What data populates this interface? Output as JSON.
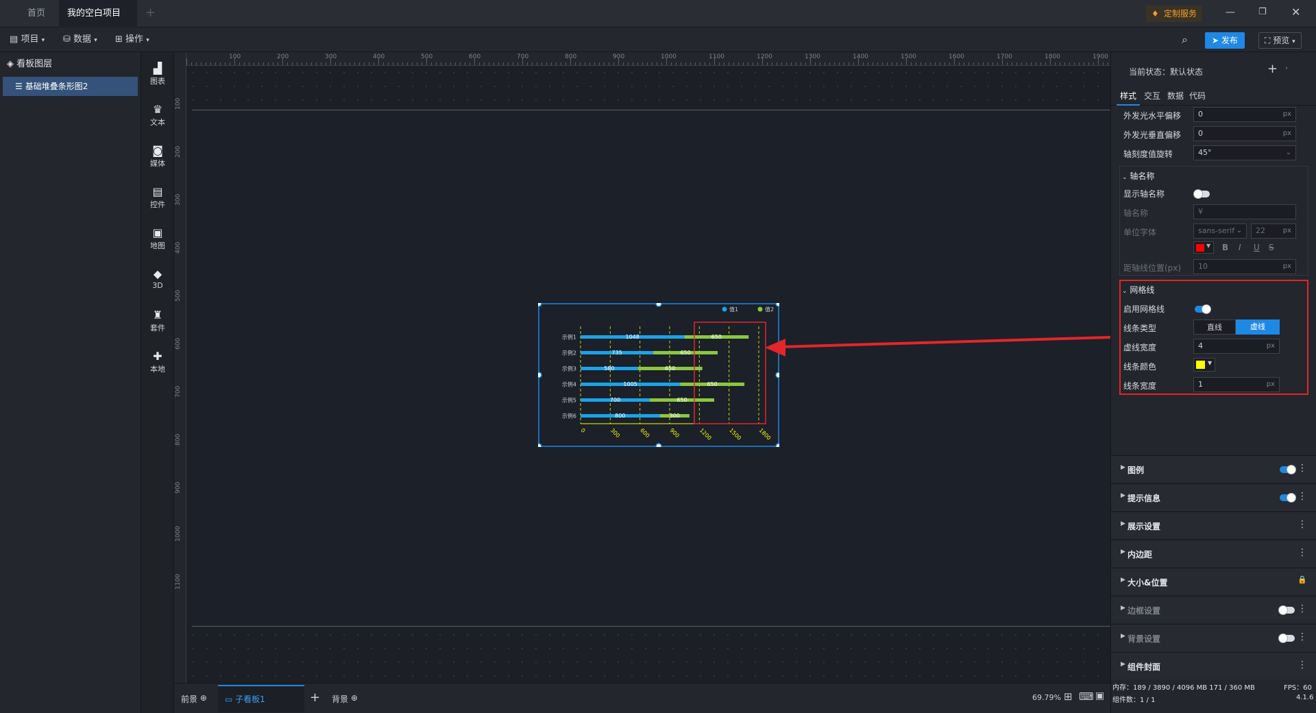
{
  "tabs": [
    {
      "label": "首页",
      "active": false
    },
    {
      "label": "我的空白项目",
      "active": true,
      "modified": true
    }
  ],
  "window": {
    "service_label": "定制服务"
  },
  "toolbar": {
    "menus": [
      "项目",
      "数据",
      "操作"
    ],
    "publish_label": "发布",
    "preview_label": "预览"
  },
  "layers": {
    "header": "看板图层",
    "items": [
      "基础堆叠条形图2"
    ]
  },
  "components": [
    "图表",
    "文本",
    "媒体",
    "控件",
    "地图",
    "3D",
    "套件",
    "本地"
  ],
  "ruler": {
    "h_ticks": [
      "100",
      "200",
      "300",
      "400",
      "500",
      "600",
      "700",
      "800",
      "900",
      "1000",
      "1100",
      "1200",
      "1300",
      "1400",
      "1500",
      "1600",
      "1700",
      "1800",
      "1900"
    ],
    "v_ticks": [
      "100",
      "200",
      "300",
      "400",
      "500",
      "600",
      "700",
      "800",
      "900",
      "1000",
      "1100"
    ]
  },
  "chart_data": {
    "type": "bar",
    "orientation": "horizontal",
    "stacked": true,
    "categories": [
      "示例1",
      "示例2",
      "示例3",
      "示例4",
      "示例5",
      "示例6"
    ],
    "series": [
      {
        "name": "值1",
        "values": [
          1048,
          735,
          580,
          1005,
          700,
          800
        ],
        "color": "#1aa3e8"
      },
      {
        "name": "值2",
        "values": [
          650,
          650,
          650,
          650,
          650,
          300
        ],
        "color": "#8cc63f"
      }
    ],
    "x_ticks": [
      "0",
      "300",
      "600",
      "900",
      "1200",
      "1500",
      "1800"
    ],
    "xlim": [
      0,
      1800
    ],
    "grid": {
      "enabled": true,
      "style": "dashed",
      "color": "#ffff00"
    },
    "legend_position": "top-right"
  },
  "bottom": {
    "foreground": "前景",
    "sub_board": "子看板1",
    "background": "背景",
    "zoom": "69.79%"
  },
  "status": {
    "memory": "内存：189 / 3890 / 4096 MB  171 / 360 MB",
    "fps": "FPS：60",
    "components": "组件数：1 / 1",
    "version": "4.1.6"
  },
  "right_panel": {
    "state_label": "当前状态：默认状态",
    "tabs": [
      "样式",
      "交互",
      "数据",
      "代码"
    ],
    "fields": {
      "glow_h_offset": {
        "label": "外发光水平偏移",
        "value": "0",
        "unit": "px"
      },
      "glow_v_offset": {
        "label": "外发光垂直偏移",
        "value": "0",
        "unit": "px"
      },
      "tick_rotation": {
        "label": "轴刻度值旋转",
        "value": "45°"
      }
    },
    "axis_name": {
      "title": "轴名称",
      "show_label": "显示轴名称",
      "name_label": "轴名称",
      "name_value": "¥",
      "font_label": "单位字体",
      "font_value": "sans-serif",
      "font_size": "22",
      "font_unit": "px",
      "distance_label": "距轴线位置(px)",
      "distance_value": "10",
      "distance_unit": "px",
      "font_color": "#ff0000"
    },
    "grid": {
      "title": "网格线",
      "enable_label": "启用网格线",
      "type_label": "线条类型",
      "type_options": [
        "直线",
        "虚线"
      ],
      "type_selected": "虚线",
      "dash_label": "虚线宽度",
      "dash_value": "4",
      "dash_unit": "px",
      "color_label": "线条颜色",
      "color_value": "#ffff00",
      "width_label": "线条宽度",
      "width_value": "1",
      "width_unit": "px"
    },
    "sections": [
      {
        "label": "图例",
        "toggle": "on"
      },
      {
        "label": "提示信息",
        "toggle": "on"
      },
      {
        "label": "展示设置",
        "toggle": "none"
      },
      {
        "label": "内边距",
        "toggle": "none"
      },
      {
        "label": "大小&位置",
        "toggle": "lock"
      },
      {
        "label": "边框设置",
        "toggle": "off"
      },
      {
        "label": "背景设置",
        "toggle": "off"
      },
      {
        "label": "组件封面",
        "toggle": "none"
      }
    ]
  }
}
